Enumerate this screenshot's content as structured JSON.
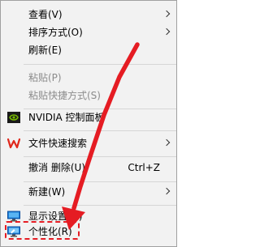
{
  "menu": {
    "items": {
      "view": {
        "label": "查看(V)"
      },
      "sort_by": {
        "label": "排序方式(O)"
      },
      "refresh": {
        "label": "刷新(E)"
      },
      "paste": {
        "label": "粘贴(P)"
      },
      "paste_shortcut": {
        "label": "粘贴快捷方式(S)"
      },
      "nvidia": {
        "label": "NVIDIA 控制面板"
      },
      "quick_search": {
        "label": "文件快速搜索"
      },
      "undo_delete": {
        "label": "撤消 删除(U)",
        "shortcut": "Ctrl+Z"
      },
      "new": {
        "label": "新建(W)"
      },
      "display_settings": {
        "label": "显示设置(D)"
      },
      "personalize": {
        "label": "个性化(R)"
      }
    }
  },
  "colors": {
    "menu_background": "#f2f2f2",
    "annotation_red": "#e51c23",
    "nvidia_green": "#76b900"
  },
  "icons": {
    "nvidia": "nvidia-logo-icon",
    "quick_search": "wps-logo-icon",
    "display_settings": "monitor-icon",
    "personalize": "personalize-monitor-icon",
    "submenu": "chevron-right-icon"
  }
}
